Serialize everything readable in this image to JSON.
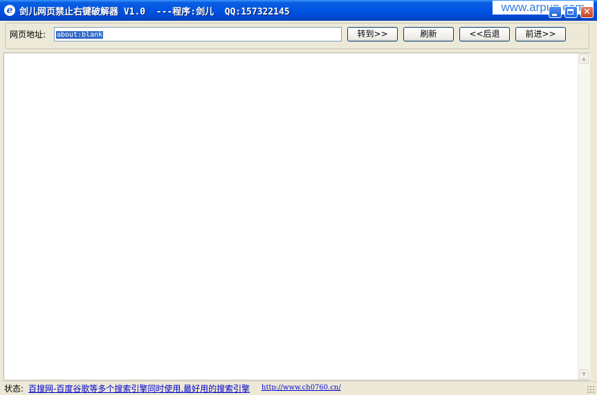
{
  "window": {
    "title": "剑儿网页禁止右键破解器 V1.0  ---程序:剑儿  QQ:157322145",
    "watermark": "www.arpun.com",
    "icon": "ie-icon",
    "close_glyph": "✕"
  },
  "toolbar": {
    "url_label": "网页地址:",
    "url_value": "about:blank",
    "go_label": "转到>>",
    "refresh_label": "刷新",
    "back_label": "<<后退",
    "forward_label": "前进>>"
  },
  "statusbar": {
    "label": "状态:",
    "link_text": "百搜网-百度谷歌等多个搜索引擎同时使用,最好用的搜索引擎",
    "url_text": "http://www.ch0760.cn/"
  },
  "colors": {
    "titlebar": "#0054e3",
    "selection": "#316ac5",
    "link": "#0000cc"
  }
}
